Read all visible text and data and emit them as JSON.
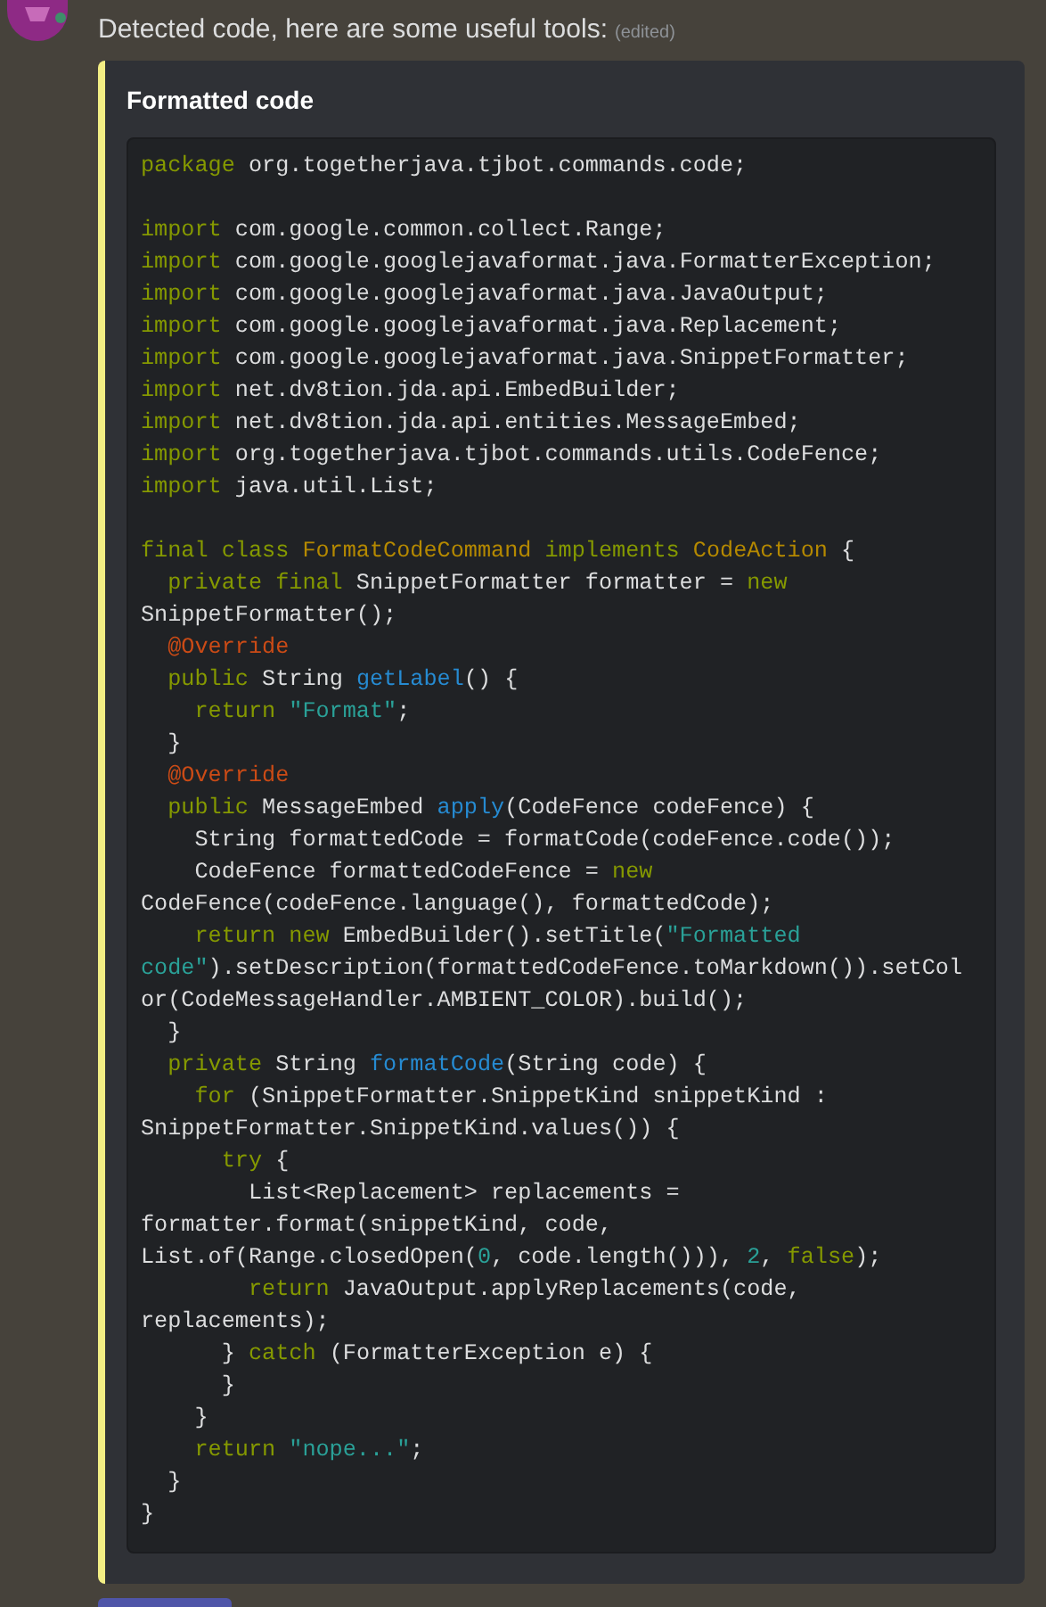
{
  "message": {
    "text": "Detected code, here are some useful tools:",
    "edited_tag": "(edited)"
  },
  "embed": {
    "title": "Formatted code",
    "color": "#f3ee84",
    "code_lines": [
      {
        "kind": "code",
        "tokens": [
          {
            "kind": "keyword",
            "text": "package"
          },
          {
            "kind": "plain",
            "text": " org.togetherjava.tjbot.commands.code;"
          }
        ]
      },
      {
        "kind": "blank"
      },
      {
        "kind": "code",
        "tokens": [
          {
            "kind": "keyword",
            "text": "import"
          },
          {
            "kind": "plain",
            "text": " com.google.common.collect.Range;"
          }
        ]
      },
      {
        "kind": "code",
        "tokens": [
          {
            "kind": "keyword",
            "text": "import"
          },
          {
            "kind": "plain",
            "text": " com.google.googlejavaformat.java.FormatterException;"
          }
        ]
      },
      {
        "kind": "code",
        "tokens": [
          {
            "kind": "keyword",
            "text": "import"
          },
          {
            "kind": "plain",
            "text": " com.google.googlejavaformat.java.JavaOutput;"
          }
        ]
      },
      {
        "kind": "code",
        "tokens": [
          {
            "kind": "keyword",
            "text": "import"
          },
          {
            "kind": "plain",
            "text": " com.google.googlejavaformat.java.Replacement;"
          }
        ]
      },
      {
        "kind": "code",
        "tokens": [
          {
            "kind": "keyword",
            "text": "import"
          },
          {
            "kind": "plain",
            "text": " com.google.googlejavaformat.java.SnippetFormatter;"
          }
        ]
      },
      {
        "kind": "code",
        "tokens": [
          {
            "kind": "keyword",
            "text": "import"
          },
          {
            "kind": "plain",
            "text": " net.dv8tion.jda.api.EmbedBuilder;"
          }
        ]
      },
      {
        "kind": "code",
        "tokens": [
          {
            "kind": "keyword",
            "text": "import"
          },
          {
            "kind": "plain",
            "text": " net.dv8tion.jda.api.entities.MessageEmbed;"
          }
        ]
      },
      {
        "kind": "code",
        "tokens": [
          {
            "kind": "keyword",
            "text": "import"
          },
          {
            "kind": "plain",
            "text": " org.togetherjava.tjbot.commands.utils.CodeFence;"
          }
        ]
      },
      {
        "kind": "code",
        "tokens": [
          {
            "kind": "keyword",
            "text": "import"
          },
          {
            "kind": "plain",
            "text": " java.util.List;"
          }
        ]
      },
      {
        "kind": "blank"
      },
      {
        "kind": "code",
        "tokens": [
          {
            "kind": "keyword",
            "text": "final class "
          },
          {
            "kind": "type",
            "text": "FormatCodeCommand"
          },
          {
            "kind": "keyword",
            "text": " implements "
          },
          {
            "kind": "type",
            "text": "CodeAction"
          },
          {
            "kind": "plain",
            "text": " {"
          }
        ]
      },
      {
        "kind": "code",
        "tokens": [
          {
            "kind": "keyword",
            "text": "  private final"
          },
          {
            "kind": "plain",
            "text": " SnippetFormatter formatter = "
          },
          {
            "kind": "keyword",
            "text": "new"
          }
        ]
      },
      {
        "kind": "code",
        "tokens": [
          {
            "kind": "plain",
            "text": "SnippetFormatter();"
          }
        ]
      },
      {
        "kind": "code",
        "tokens": [
          {
            "kind": "annotation",
            "text": "  @Override"
          }
        ]
      },
      {
        "kind": "code",
        "tokens": [
          {
            "kind": "keyword",
            "text": "  public"
          },
          {
            "kind": "plain",
            "text": " String "
          },
          {
            "kind": "function",
            "text": "getLabel"
          },
          {
            "kind": "plain",
            "text": "() {"
          }
        ]
      },
      {
        "kind": "code",
        "tokens": [
          {
            "kind": "keyword",
            "text": "    return"
          },
          {
            "kind": "string",
            "text": " \"Format\""
          },
          {
            "kind": "plain",
            "text": ";"
          }
        ]
      },
      {
        "kind": "code",
        "tokens": [
          {
            "kind": "plain",
            "text": "  }"
          }
        ]
      },
      {
        "kind": "code",
        "tokens": [
          {
            "kind": "annotation",
            "text": "  @Override"
          }
        ]
      },
      {
        "kind": "code",
        "tokens": [
          {
            "kind": "keyword",
            "text": "  public"
          },
          {
            "kind": "plain",
            "text": " MessageEmbed "
          },
          {
            "kind": "function",
            "text": "apply"
          },
          {
            "kind": "plain",
            "text": "(CodeFence codeFence) {"
          }
        ]
      },
      {
        "kind": "code",
        "tokens": [
          {
            "kind": "plain",
            "text": "    String formattedCode = formatCode(codeFence.code());"
          }
        ]
      },
      {
        "kind": "code",
        "tokens": [
          {
            "kind": "plain",
            "text": "    CodeFence formattedCodeFence = "
          },
          {
            "kind": "keyword",
            "text": "new"
          }
        ]
      },
      {
        "kind": "code",
        "tokens": [
          {
            "kind": "plain",
            "text": "CodeFence(codeFence.language(), formattedCode);"
          }
        ]
      },
      {
        "kind": "code",
        "tokens": [
          {
            "kind": "keyword",
            "text": "    return new"
          },
          {
            "kind": "plain",
            "text": " EmbedBuilder().setTitle("
          },
          {
            "kind": "string",
            "text": "\"Formatted"
          }
        ]
      },
      {
        "kind": "code",
        "tokens": [
          {
            "kind": "string",
            "text": "code\""
          },
          {
            "kind": "plain",
            "text": ").setDescription(formattedCodeFence.toMarkdown()).setCol"
          }
        ]
      },
      {
        "kind": "code",
        "tokens": [
          {
            "kind": "plain",
            "text": "or(CodeMessageHandler.AMBIENT_COLOR).build();"
          }
        ]
      },
      {
        "kind": "code",
        "tokens": [
          {
            "kind": "plain",
            "text": "  }"
          }
        ]
      },
      {
        "kind": "code",
        "tokens": [
          {
            "kind": "keyword",
            "text": "  private"
          },
          {
            "kind": "plain",
            "text": " String "
          },
          {
            "kind": "function",
            "text": "formatCode"
          },
          {
            "kind": "plain",
            "text": "(String code) {"
          }
        ]
      },
      {
        "kind": "code",
        "tokens": [
          {
            "kind": "keyword",
            "text": "    for"
          },
          {
            "kind": "plain",
            "text": " (SnippetFormatter.SnippetKind snippetKind :"
          }
        ]
      },
      {
        "kind": "code",
        "tokens": [
          {
            "kind": "plain",
            "text": "SnippetFormatter.SnippetKind.values()) {"
          }
        ]
      },
      {
        "kind": "code",
        "tokens": [
          {
            "kind": "keyword",
            "text": "      try"
          },
          {
            "kind": "plain",
            "text": " {"
          }
        ]
      },
      {
        "kind": "code",
        "tokens": [
          {
            "kind": "plain",
            "text": "        List<Replacement> replacements ="
          }
        ]
      },
      {
        "kind": "code",
        "tokens": [
          {
            "kind": "plain",
            "text": "formatter.format(snippetKind, code,"
          }
        ]
      },
      {
        "kind": "code",
        "tokens": [
          {
            "kind": "plain",
            "text": "List.of(Range.closedOpen("
          },
          {
            "kind": "number",
            "text": "0"
          },
          {
            "kind": "plain",
            "text": ", code.length())), "
          },
          {
            "kind": "number",
            "text": "2"
          },
          {
            "kind": "plain",
            "text": ", "
          },
          {
            "kind": "keyword",
            "text": "false"
          },
          {
            "kind": "plain",
            "text": ");"
          }
        ]
      },
      {
        "kind": "code",
        "tokens": [
          {
            "kind": "keyword",
            "text": "        return"
          },
          {
            "kind": "plain",
            "text": " JavaOutput.applyReplacements(code,"
          }
        ]
      },
      {
        "kind": "code",
        "tokens": [
          {
            "kind": "plain",
            "text": "replacements);"
          }
        ]
      },
      {
        "kind": "code",
        "tokens": [
          {
            "kind": "plain",
            "text": "      } "
          },
          {
            "kind": "keyword",
            "text": "catch"
          },
          {
            "kind": "plain",
            "text": " (FormatterException e) {"
          }
        ]
      },
      {
        "kind": "code",
        "tokens": [
          {
            "kind": "plain",
            "text": "      }"
          }
        ]
      },
      {
        "kind": "code",
        "tokens": [
          {
            "kind": "plain",
            "text": "    }"
          }
        ]
      },
      {
        "kind": "code",
        "tokens": [
          {
            "kind": "keyword",
            "text": "    return"
          },
          {
            "kind": "string",
            "text": " \"nope...\""
          },
          {
            "kind": "plain",
            "text": ";"
          }
        ]
      },
      {
        "kind": "code",
        "tokens": [
          {
            "kind": "plain",
            "text": "  }"
          }
        ]
      },
      {
        "kind": "code",
        "tokens": [
          {
            "kind": "plain",
            "text": "}"
          }
        ]
      }
    ]
  }
}
